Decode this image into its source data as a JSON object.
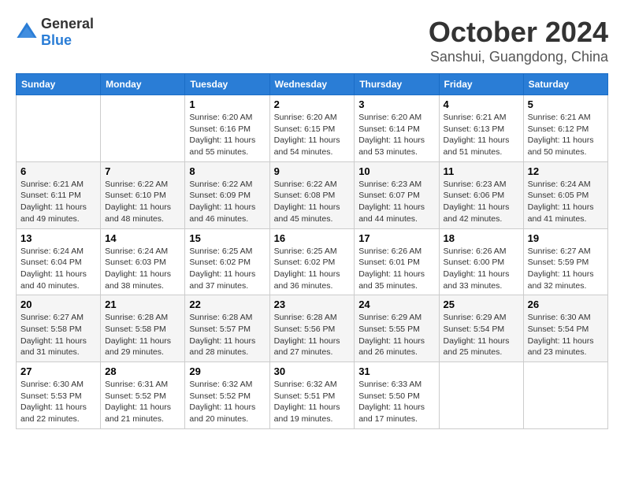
{
  "logo": {
    "general": "General",
    "blue": "Blue"
  },
  "title": {
    "month": "October 2024",
    "location": "Sanshui, Guangdong, China"
  },
  "headers": [
    "Sunday",
    "Monday",
    "Tuesday",
    "Wednesday",
    "Thursday",
    "Friday",
    "Saturday"
  ],
  "weeks": [
    [
      {
        "day": "",
        "sunrise": "",
        "sunset": "",
        "daylight": ""
      },
      {
        "day": "",
        "sunrise": "",
        "sunset": "",
        "daylight": ""
      },
      {
        "day": "1",
        "sunrise": "Sunrise: 6:20 AM",
        "sunset": "Sunset: 6:16 PM",
        "daylight": "Daylight: 11 hours and 55 minutes."
      },
      {
        "day": "2",
        "sunrise": "Sunrise: 6:20 AM",
        "sunset": "Sunset: 6:15 PM",
        "daylight": "Daylight: 11 hours and 54 minutes."
      },
      {
        "day": "3",
        "sunrise": "Sunrise: 6:20 AM",
        "sunset": "Sunset: 6:14 PM",
        "daylight": "Daylight: 11 hours and 53 minutes."
      },
      {
        "day": "4",
        "sunrise": "Sunrise: 6:21 AM",
        "sunset": "Sunset: 6:13 PM",
        "daylight": "Daylight: 11 hours and 51 minutes."
      },
      {
        "day": "5",
        "sunrise": "Sunrise: 6:21 AM",
        "sunset": "Sunset: 6:12 PM",
        "daylight": "Daylight: 11 hours and 50 minutes."
      }
    ],
    [
      {
        "day": "6",
        "sunrise": "Sunrise: 6:21 AM",
        "sunset": "Sunset: 6:11 PM",
        "daylight": "Daylight: 11 hours and 49 minutes."
      },
      {
        "day": "7",
        "sunrise": "Sunrise: 6:22 AM",
        "sunset": "Sunset: 6:10 PM",
        "daylight": "Daylight: 11 hours and 48 minutes."
      },
      {
        "day": "8",
        "sunrise": "Sunrise: 6:22 AM",
        "sunset": "Sunset: 6:09 PM",
        "daylight": "Daylight: 11 hours and 46 minutes."
      },
      {
        "day": "9",
        "sunrise": "Sunrise: 6:22 AM",
        "sunset": "Sunset: 6:08 PM",
        "daylight": "Daylight: 11 hours and 45 minutes."
      },
      {
        "day": "10",
        "sunrise": "Sunrise: 6:23 AM",
        "sunset": "Sunset: 6:07 PM",
        "daylight": "Daylight: 11 hours and 44 minutes."
      },
      {
        "day": "11",
        "sunrise": "Sunrise: 6:23 AM",
        "sunset": "Sunset: 6:06 PM",
        "daylight": "Daylight: 11 hours and 42 minutes."
      },
      {
        "day": "12",
        "sunrise": "Sunrise: 6:24 AM",
        "sunset": "Sunset: 6:05 PM",
        "daylight": "Daylight: 11 hours and 41 minutes."
      }
    ],
    [
      {
        "day": "13",
        "sunrise": "Sunrise: 6:24 AM",
        "sunset": "Sunset: 6:04 PM",
        "daylight": "Daylight: 11 hours and 40 minutes."
      },
      {
        "day": "14",
        "sunrise": "Sunrise: 6:24 AM",
        "sunset": "Sunset: 6:03 PM",
        "daylight": "Daylight: 11 hours and 38 minutes."
      },
      {
        "day": "15",
        "sunrise": "Sunrise: 6:25 AM",
        "sunset": "Sunset: 6:02 PM",
        "daylight": "Daylight: 11 hours and 37 minutes."
      },
      {
        "day": "16",
        "sunrise": "Sunrise: 6:25 AM",
        "sunset": "Sunset: 6:02 PM",
        "daylight": "Daylight: 11 hours and 36 minutes."
      },
      {
        "day": "17",
        "sunrise": "Sunrise: 6:26 AM",
        "sunset": "Sunset: 6:01 PM",
        "daylight": "Daylight: 11 hours and 35 minutes."
      },
      {
        "day": "18",
        "sunrise": "Sunrise: 6:26 AM",
        "sunset": "Sunset: 6:00 PM",
        "daylight": "Daylight: 11 hours and 33 minutes."
      },
      {
        "day": "19",
        "sunrise": "Sunrise: 6:27 AM",
        "sunset": "Sunset: 5:59 PM",
        "daylight": "Daylight: 11 hours and 32 minutes."
      }
    ],
    [
      {
        "day": "20",
        "sunrise": "Sunrise: 6:27 AM",
        "sunset": "Sunset: 5:58 PM",
        "daylight": "Daylight: 11 hours and 31 minutes."
      },
      {
        "day": "21",
        "sunrise": "Sunrise: 6:28 AM",
        "sunset": "Sunset: 5:58 PM",
        "daylight": "Daylight: 11 hours and 29 minutes."
      },
      {
        "day": "22",
        "sunrise": "Sunrise: 6:28 AM",
        "sunset": "Sunset: 5:57 PM",
        "daylight": "Daylight: 11 hours and 28 minutes."
      },
      {
        "day": "23",
        "sunrise": "Sunrise: 6:28 AM",
        "sunset": "Sunset: 5:56 PM",
        "daylight": "Daylight: 11 hours and 27 minutes."
      },
      {
        "day": "24",
        "sunrise": "Sunrise: 6:29 AM",
        "sunset": "Sunset: 5:55 PM",
        "daylight": "Daylight: 11 hours and 26 minutes."
      },
      {
        "day": "25",
        "sunrise": "Sunrise: 6:29 AM",
        "sunset": "Sunset: 5:54 PM",
        "daylight": "Daylight: 11 hours and 25 minutes."
      },
      {
        "day": "26",
        "sunrise": "Sunrise: 6:30 AM",
        "sunset": "Sunset: 5:54 PM",
        "daylight": "Daylight: 11 hours and 23 minutes."
      }
    ],
    [
      {
        "day": "27",
        "sunrise": "Sunrise: 6:30 AM",
        "sunset": "Sunset: 5:53 PM",
        "daylight": "Daylight: 11 hours and 22 minutes."
      },
      {
        "day": "28",
        "sunrise": "Sunrise: 6:31 AM",
        "sunset": "Sunset: 5:52 PM",
        "daylight": "Daylight: 11 hours and 21 minutes."
      },
      {
        "day": "29",
        "sunrise": "Sunrise: 6:32 AM",
        "sunset": "Sunset: 5:52 PM",
        "daylight": "Daylight: 11 hours and 20 minutes."
      },
      {
        "day": "30",
        "sunrise": "Sunrise: 6:32 AM",
        "sunset": "Sunset: 5:51 PM",
        "daylight": "Daylight: 11 hours and 19 minutes."
      },
      {
        "day": "31",
        "sunrise": "Sunrise: 6:33 AM",
        "sunset": "Sunset: 5:50 PM",
        "daylight": "Daylight: 11 hours and 17 minutes."
      },
      {
        "day": "",
        "sunrise": "",
        "sunset": "",
        "daylight": ""
      },
      {
        "day": "",
        "sunrise": "",
        "sunset": "",
        "daylight": ""
      }
    ]
  ]
}
